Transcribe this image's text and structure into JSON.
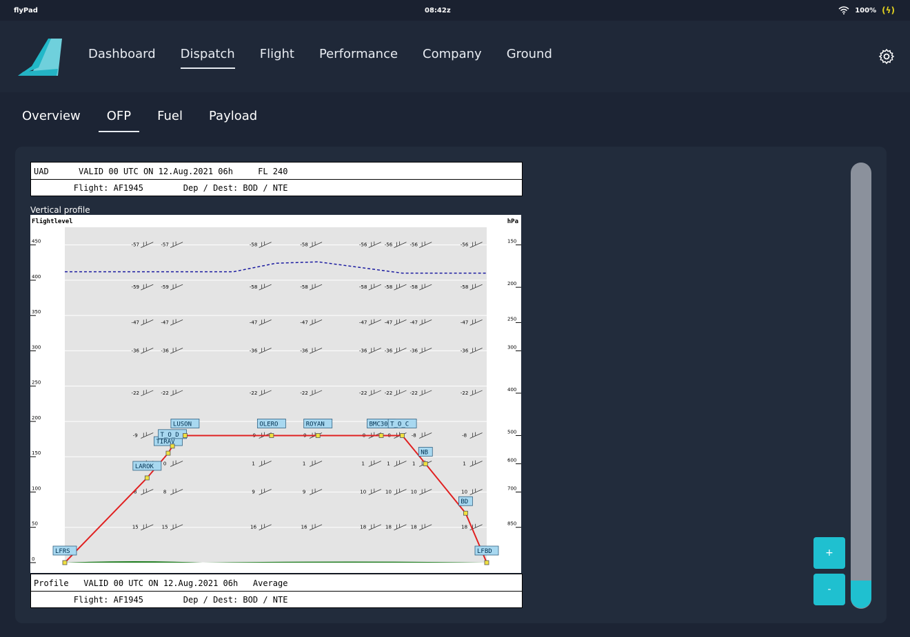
{
  "status_bar": {
    "app_name": "flyPad",
    "time": "08:42z",
    "battery": "100%",
    "charging_icon": "(ϟ)"
  },
  "main_nav": {
    "items": [
      "Dashboard",
      "Dispatch",
      "Flight",
      "Performance",
      "Company",
      "Ground"
    ],
    "active": "Dispatch"
  },
  "sub_nav": {
    "items": [
      "Overview",
      "OFP",
      "Fuel",
      "Payload"
    ],
    "active": "OFP"
  },
  "document": {
    "header_line1": "UAD      VALID 00 UTC ON 12.Aug.2021 06h     FL 240",
    "header_line2": "        Flight: AF1945        Dep / Dest: BOD / NTE",
    "section_title": "Vertical profile",
    "footer_line1": "Profile   VALID 00 UTC ON 12.Aug.2021 06h   Average",
    "footer_line2": "        Flight: AF1945        Dep / Dest: BOD / NTE"
  },
  "chart_data": {
    "type": "line",
    "title": "",
    "xlabel": "",
    "ylabel": "Flightlevel",
    "y2label": "hPa",
    "ylim": [
      0,
      475
    ],
    "y_ticks": [
      0,
      50,
      100,
      150,
      200,
      250,
      300,
      350,
      400,
      450
    ],
    "hpa_ticks": [
      {
        "label": "150",
        "fl": 450
      },
      {
        "label": "200",
        "fl": 390
      },
      {
        "label": "250",
        "fl": 340
      },
      {
        "label": "300",
        "fl": 300
      },
      {
        "label": "400",
        "fl": 240
      },
      {
        "label": "500",
        "fl": 180
      },
      {
        "label": "600",
        "fl": 140
      },
      {
        "label": "700",
        "fl": 100
      },
      {
        "label": "850",
        "fl": 50
      }
    ],
    "series": [
      {
        "name": "",
        "color": "#e02020",
        "points": [
          {
            "x": 0,
            "fl": 0,
            "label": "LFRS"
          },
          {
            "x": 0.195,
            "fl": 120,
            "label": "LAROK"
          },
          {
            "x": 0.245,
            "fl": 155,
            "label": "TIRAV"
          },
          {
            "x": 0.255,
            "fl": 165,
            "label": "T_O_D"
          },
          {
            "x": 0.285,
            "fl": 180,
            "label": "LUSON"
          },
          {
            "x": 0.49,
            "fl": 180,
            "label": "OLERO"
          },
          {
            "x": 0.6,
            "fl": 180,
            "label": "ROYAN"
          },
          {
            "x": 0.75,
            "fl": 180,
            "label": "BMC30"
          },
          {
            "x": 0.8,
            "fl": 180,
            "label": "T_O_C"
          },
          {
            "x": 0.855,
            "fl": 140,
            "label": "NB"
          },
          {
            "x": 0.95,
            "fl": 70,
            "label": "BD"
          },
          {
            "x": 1,
            "fl": 0,
            "label": "LFBD"
          }
        ]
      },
      {
        "name": "",
        "color": "#1a1aa0",
        "style": "dashed",
        "points": [
          {
            "x": 0,
            "fl": 412
          },
          {
            "x": 0.4,
            "fl": 412
          },
          {
            "x": 0.5,
            "fl": 424
          },
          {
            "x": 0.6,
            "fl": 426
          },
          {
            "x": 0.7,
            "fl": 418
          },
          {
            "x": 0.8,
            "fl": 410
          },
          {
            "x": 1,
            "fl": 410
          }
        ]
      }
    ],
    "temperature_columns": [
      0.19,
      0.26,
      0.47,
      0.59,
      0.73,
      0.79,
      0.85,
      0.97
    ],
    "temperature_rows": [
      {
        "fl": 450,
        "values": [
          "-57",
          "-57",
          "-58",
          "-58",
          "-56",
          "-56",
          "-56",
          "-56"
        ]
      },
      {
        "fl": 390,
        "values": [
          "-59",
          "-59",
          "-58",
          "-58",
          "-58",
          "-58",
          "-58",
          "-58"
        ]
      },
      {
        "fl": 340,
        "values": [
          "-47",
          "-47",
          "-47",
          "-47",
          "-47",
          "-47",
          "-47",
          "-47"
        ]
      },
      {
        "fl": 300,
        "values": [
          "-36",
          "-36",
          "-36",
          "-36",
          "-36",
          "-36",
          "-36",
          "-36"
        ]
      },
      {
        "fl": 240,
        "values": [
          "-22",
          "-22",
          "-22",
          "-22",
          "-22",
          "-22",
          "-22",
          "-22"
        ]
      },
      {
        "fl": 180,
        "values": [
          "-9",
          "-9",
          "-9",
          "-9",
          "-8",
          "-8",
          "-8",
          "-8"
        ]
      },
      {
        "fl": 140,
        "values": [
          "0",
          "0",
          "1",
          "1",
          "1",
          "1",
          "1",
          "1"
        ]
      },
      {
        "fl": 100,
        "values": [
          "8",
          "8",
          "9",
          "9",
          "10",
          "10",
          "10",
          "10"
        ]
      },
      {
        "fl": 50,
        "values": [
          "15",
          "15",
          "16",
          "16",
          "18",
          "18",
          "18",
          "18"
        ]
      }
    ]
  },
  "zoom": {
    "plus": "+",
    "minus": "-"
  }
}
